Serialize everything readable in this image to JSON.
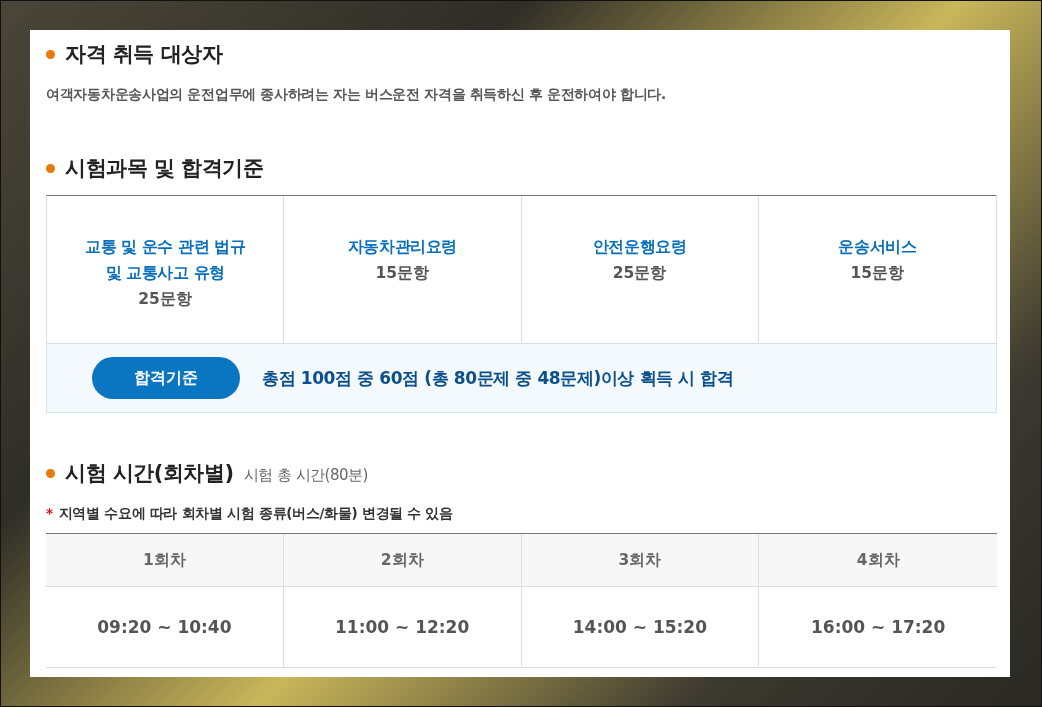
{
  "target_section": {
    "title": "자격 취득 대상자",
    "description": "여객자동차운송사업의 운전업무에 종사하려는 자는 버스운전 자격을 취득하신 후 운전하여야 합니다."
  },
  "subjects_section": {
    "title": "시험과목 및 합격기준",
    "subjects": [
      {
        "name": "교통 및 운수 관련 법규\n및 교통사고 유형",
        "count": "25문항"
      },
      {
        "name": "자동차관리요령",
        "count": "15문항"
      },
      {
        "name": "안전운행요령",
        "count": "25문항"
      },
      {
        "name": "운송서비스",
        "count": "15문항"
      }
    ],
    "pass_criteria": {
      "label": "합격기준",
      "text": "총점 100점 중 60점 (총 80문제 중 48문제)이상 획득 시 합격"
    }
  },
  "schedule_section": {
    "title": "시험 시간(회차별)",
    "subtitle": "시험 총 시간(80분)",
    "note_mark": "*",
    "note": "지역별 수요에 따라 회차별 시험 종류(버스/화물) 변경될 수 있음",
    "sessions": [
      {
        "name": "1회차",
        "time": "09:20 ~ 10:40"
      },
      {
        "name": "2회차",
        "time": "11:00 ~ 12:20"
      },
      {
        "name": "3회차",
        "time": "14:00 ~ 15:20"
      },
      {
        "name": "4회차",
        "time": "16:00 ~ 17:20"
      }
    ]
  }
}
